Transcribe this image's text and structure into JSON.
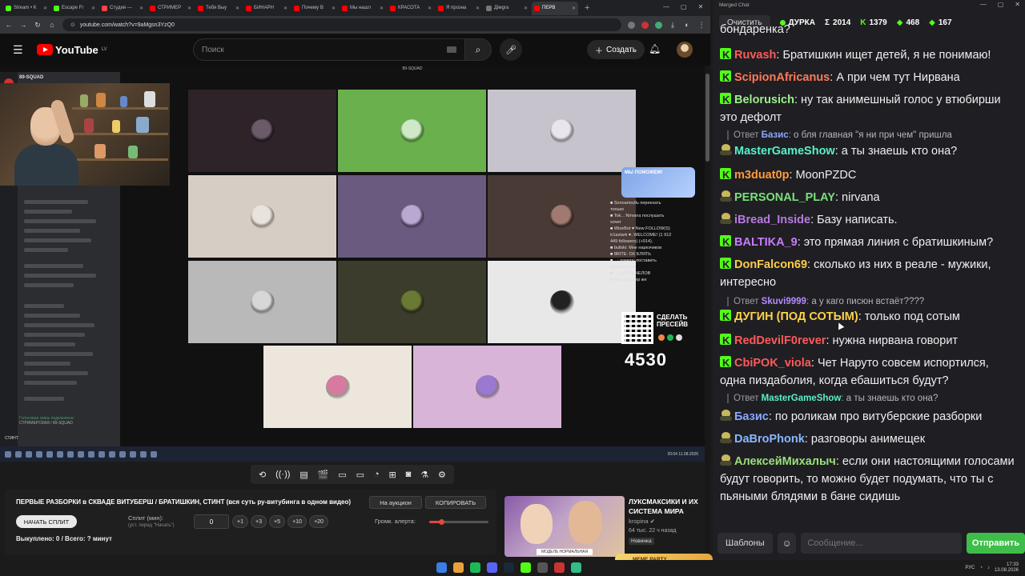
{
  "browser": {
    "tabs": [
      {
        "label": "Stream • K",
        "color": "#53fc18",
        "active": false
      },
      {
        "label": "Escape Fr",
        "color": "#53fc18",
        "active": false
      },
      {
        "label": "Студия —",
        "color": "#ff4444",
        "active": false
      },
      {
        "label": "СТРИМЕР",
        "color": "#ff0000",
        "active": false
      },
      {
        "label": "Тебя Выу",
        "color": "#ff0000",
        "active": false
      },
      {
        "label": "БИНАРН",
        "color": "#ff0000",
        "active": false
      },
      {
        "label": "Почему В",
        "color": "#ff0000",
        "active": false
      },
      {
        "label": "Мы нашл",
        "color": "#ff0000",
        "active": false
      },
      {
        "label": "КРАСОТА",
        "color": "#ff0000",
        "active": false
      },
      {
        "label": "Я прозна",
        "color": "#ff0000",
        "active": false
      },
      {
        "label": "Дімgra",
        "color": "#777777",
        "active": false
      },
      {
        "label": "ПЕРВ",
        "color": "#ff0000",
        "active": true
      }
    ],
    "url": "youtube.com/watch?v=9aMgsn3YzQ0"
  },
  "youtube": {
    "logo": "YouTube",
    "region": "LV",
    "search_placeholder": "Поиск",
    "create_label": "Создать"
  },
  "video": {
    "window_title": "89-SQUAD",
    "discord_server": "89-SQUAD",
    "discord_voice": "Голосовая связь подключена",
    "discord_voice_sub": "СТРИМЕРСКАЯ / 89-SQUAD",
    "discord_user": "СТИНТ",
    "minichat_lines": [
      "■ Sonoariou9ь переехать",
      "только",
      "■ Tok... Nirvana послушать",
      "хочет",
      "■ WizeBot ♥ New FOLLOW(S)",
      "tr1astark ♥, WELCOME! (1 912",
      "449 followers) (+914).",
      "■ bullski: Мне нарезчиков",
      "",
      "■ 8RITE: ОХ БЛЯТЬ",
      "■ ...: камеру поставить",
      "для скок вас",
      "■ ...: ЕБАТЬ ЧЕЛОВ",
      "опера браузер же"
    ],
    "brand_card_text": "МЫ ПОМОЖЕМ!",
    "presib_label": "СДЕЛАТЬ ПРЕСЕЙВ",
    "counter": "4530",
    "taskbar_clock": "20:04 11.08.2026"
  },
  "player_tools": [
    "⟲",
    "((·))",
    "▤",
    "🎬",
    "▭",
    "▭",
    "◔",
    "⊞",
    "◙",
    "⚗",
    "⚙"
  ],
  "auction": {
    "title": "ПЕРВЫЕ РАЗБОРКИ в СКВАДЕ ВИТУБЕРШ / БРАТИШКИН, СТИНТ (вся суть ру-витубинга в одном видео)",
    "on_auction_label": "На аукцион",
    "copy_label": "КОПИРОВАТЬ",
    "start_split_label": "НАЧАТЬ СПЛИТ",
    "split_label": "Сплит (мин):",
    "split_hint": "(уст. перед \"Начать\")",
    "split_value": "0",
    "increments": [
      "+1",
      "+3",
      "+5",
      "+10",
      "+20"
    ],
    "alert_volume_label": "Громк. алерта:",
    "alert_volume": 0.2,
    "status": "Выкуплено: 0 / Всего: ? минут"
  },
  "recommended": {
    "title": "ЛУКСМАКСИКИ И ИХ СИСТЕМА МИРА",
    "channel": "kropina",
    "meta": "64 тыс.   22 ч назад",
    "badge": "Новинка",
    "thumb_caption": "МОДЕЛЬ НОРМАЛЬНАЯ"
  },
  "meme_party": "MEME PARTY",
  "tray": {
    "lang": "РУС",
    "time": "17:33",
    "date": "13.08.2026"
  },
  "chat": {
    "window_title": "Merged Chat",
    "clear_label": "Очистить",
    "streamer": "ДУРКА",
    "stats": [
      {
        "icon": "Σ",
        "value": "2014"
      },
      {
        "icon": "K",
        "value": "1379"
      },
      {
        "icon": "◆",
        "value": "468"
      },
      {
        "icon": "◆",
        "value": "167"
      }
    ],
    "partial_top": "бондаренка?",
    "messages": [
      {
        "platform": "kick",
        "nick": "Ruvash",
        "color": "#ff5a5a",
        "text": "Братишкин ищет детей, я не понимаю!"
      },
      {
        "platform": "kick",
        "nick": "ScipionAfricanus",
        "color": "#ff7a5a",
        "text": "А при чем тут Нирвана"
      },
      {
        "platform": "kick",
        "nick": "Belorusich",
        "color": "#9cf08a",
        "text": "ну так анимешный голос у втюбирши это дефолт"
      },
      {
        "platform": "kick",
        "nick": "MasterGameShow",
        "color": "#5aefc8",
        "text": "а ты знаешь кто она?",
        "reply_to": "Базис",
        "reply_text": "о бля главная \"я ни при чем\" пришла",
        "icon": "twitch"
      },
      {
        "platform": "kick",
        "nick": "m3duat0p",
        "color": "#ff9a3a",
        "text": "MoonPZDC"
      },
      {
        "platform": "twitch",
        "nick": "PERSONAL_PLAY",
        "color": "#7ae07a",
        "text": "nirvana"
      },
      {
        "platform": "twitch",
        "nick": "iBread_Inside",
        "color": "#b87adf",
        "text": "Базу написать."
      },
      {
        "platform": "kick",
        "nick": "BALTIKA_9",
        "color": "#c97bff",
        "text": "это прямая линия с братишкиным?"
      },
      {
        "platform": "kick",
        "nick": "DonFalcon69",
        "color": "#ffcc4a",
        "text": "сколько из них в реале - мужики, интересно"
      },
      {
        "platform": "kick",
        "nick": "ДУГИН (ПОД СОТЫМ)",
        "color": "#ffd24a",
        "text": "только под сотым",
        "reply_to": "Skuvi9999",
        "reply_text": "а у каго писюн встаёт????"
      },
      {
        "platform": "kick",
        "nick": "RedDevilF0rever",
        "color": "#ff5a5a",
        "text": "нужна нирвана говорит"
      },
      {
        "platform": "kick",
        "nick": "CbiPOK_viola",
        "color": "#ff5a5a",
        "text": "Чет Наруто совсем испортился, одна пиздаболия, когда ебашиться будут?"
      },
      {
        "platform": "twitch",
        "nick": "Базис",
        "color": "#8aa8ff",
        "text": "по роликам про витуберские разборки",
        "reply_to": "MasterGameShow",
        "reply_text": "а ты знаешь кто она?"
      },
      {
        "platform": "twitch",
        "nick": "DaBroPhonk",
        "color": "#8ab8ff",
        "text": "разговоры анимещек"
      },
      {
        "platform": "twitch",
        "nick": "АлексейМихалыч",
        "color": "#9ae07a",
        "text": "если они  настоящими голосами будут говорить, то можно будет подумать, что ты с пьяными блядями в бане сидишь"
      }
    ],
    "templates_label": "Шаблоны",
    "input_placeholder": "Сообщение...",
    "send_label": "Отправить"
  }
}
